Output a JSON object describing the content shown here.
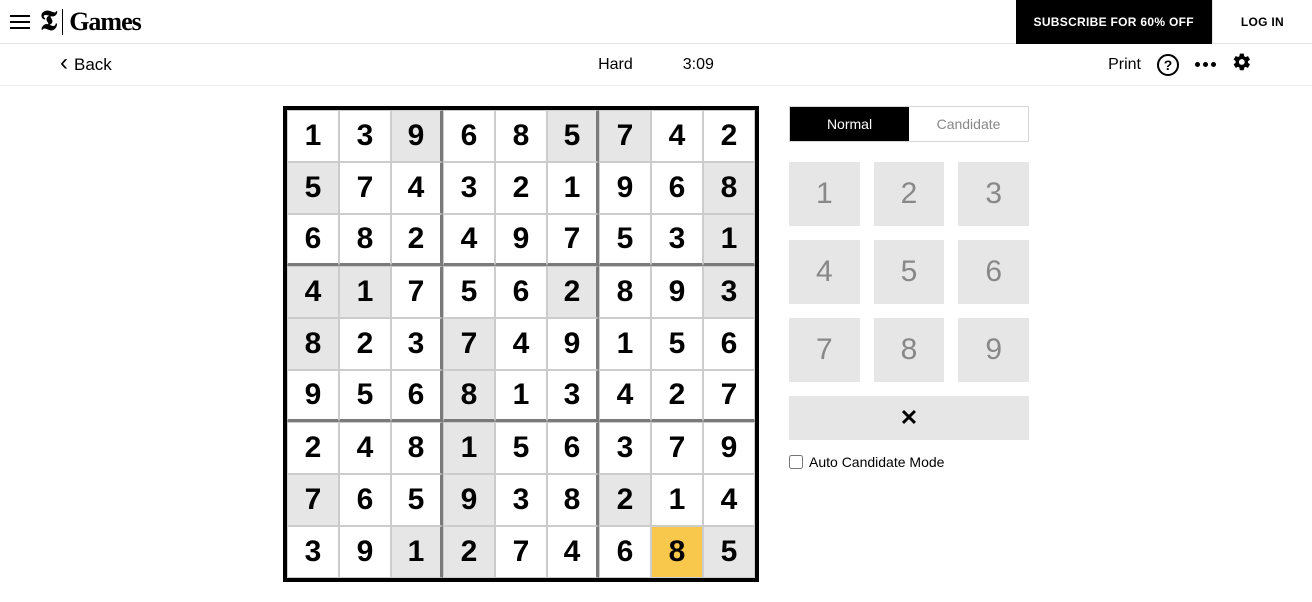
{
  "header": {
    "logo_t": "𝕿",
    "logo_games": "Games",
    "subscribe": "SUBSCRIBE FOR 60% OFF",
    "login": "LOG IN"
  },
  "secbar": {
    "back": "Back",
    "difficulty": "Hard",
    "timer": "3:09",
    "print": "Print"
  },
  "modes": {
    "normal": "Normal",
    "candidate": "Candidate"
  },
  "numpad": [
    "1",
    "2",
    "3",
    "4",
    "5",
    "6",
    "7",
    "8",
    "9"
  ],
  "clear_glyph": "✕",
  "auto_label": "Auto Candidate Mode",
  "board": {
    "values": [
      [
        "1",
        "3",
        "9",
        "6",
        "8",
        "5",
        "7",
        "4",
        "2"
      ],
      [
        "5",
        "7",
        "4",
        "3",
        "2",
        "1",
        "9",
        "6",
        "8"
      ],
      [
        "6",
        "8",
        "2",
        "4",
        "9",
        "7",
        "5",
        "3",
        "1"
      ],
      [
        "4",
        "1",
        "7",
        "5",
        "6",
        "2",
        "8",
        "9",
        "3"
      ],
      [
        "8",
        "2",
        "3",
        "7",
        "4",
        "9",
        "1",
        "5",
        "6"
      ],
      [
        "9",
        "5",
        "6",
        "8",
        "1",
        "3",
        "4",
        "2",
        "7"
      ],
      [
        "2",
        "4",
        "8",
        "1",
        "5",
        "6",
        "3",
        "7",
        "9"
      ],
      [
        "7",
        "6",
        "5",
        "9",
        "3",
        "8",
        "2",
        "1",
        "4"
      ],
      [
        "3",
        "9",
        "1",
        "2",
        "7",
        "4",
        "6",
        "8",
        "5"
      ]
    ],
    "given": [
      [
        0,
        0,
        1,
        0,
        0,
        1,
        1,
        0,
        0
      ],
      [
        1,
        0,
        0,
        0,
        0,
        0,
        0,
        0,
        1
      ],
      [
        0,
        0,
        0,
        0,
        0,
        0,
        0,
        0,
        1
      ],
      [
        1,
        1,
        0,
        0,
        0,
        1,
        0,
        0,
        1
      ],
      [
        1,
        0,
        0,
        1,
        0,
        0,
        0,
        0,
        0
      ],
      [
        0,
        0,
        0,
        1,
        0,
        0,
        0,
        0,
        0
      ],
      [
        0,
        0,
        0,
        1,
        0,
        0,
        0,
        0,
        0
      ],
      [
        1,
        0,
        0,
        1,
        0,
        0,
        1,
        0,
        0
      ],
      [
        0,
        0,
        1,
        1,
        0,
        0,
        0,
        0,
        1
      ]
    ],
    "selected": [
      8,
      7
    ]
  }
}
